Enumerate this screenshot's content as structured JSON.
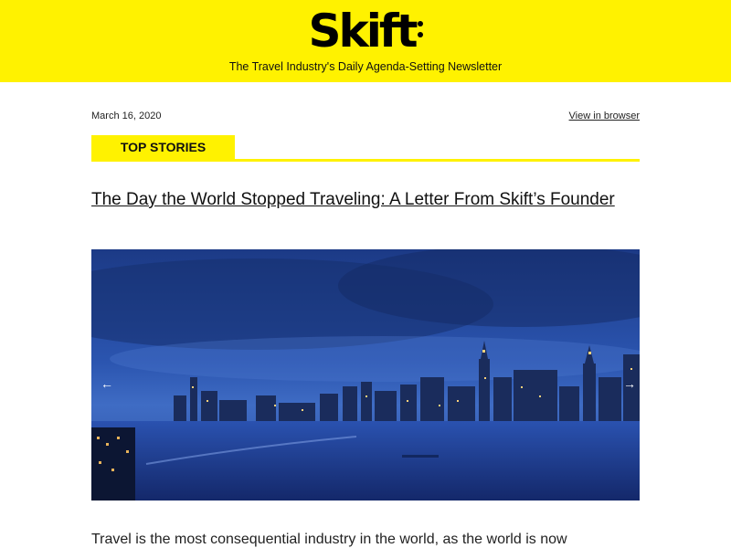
{
  "header": {
    "logo_text": "Skift",
    "tagline": "The Travel Industry's Daily Agenda-Setting Newsletter",
    "background_color": "#fff200"
  },
  "meta": {
    "date": "March 16, 2020",
    "view_in_browser": "View in browser"
  },
  "section": {
    "label": "TOP STORIES"
  },
  "article": {
    "headline": "The Day the World Stopped Traveling: A Letter From Skift’s Founder",
    "image_description_icon": "city-skyline-image",
    "prev_arrow": "←",
    "next_arrow": "→",
    "body_excerpt": "Travel is the most consequential industry in the world, as the world is now"
  }
}
